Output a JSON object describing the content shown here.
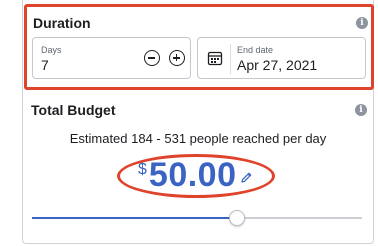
{
  "duration": {
    "title": "Duration",
    "info_icon": "info-icon",
    "days": {
      "label": "Days",
      "value": "7"
    },
    "end_date": {
      "label": "End date",
      "value": "Apr 27, 2021",
      "icon": "calendar-icon"
    }
  },
  "budget": {
    "title": "Total Budget",
    "info_icon": "info-icon",
    "estimate_text": "Estimated 184 - 531 people reached per day",
    "currency_symbol": "$",
    "amount": "50.00",
    "edit_icon": "pencil-icon",
    "slider_fraction": 0.62
  },
  "colors": {
    "accent": "#3b63c4",
    "highlight": "#e0432c"
  }
}
